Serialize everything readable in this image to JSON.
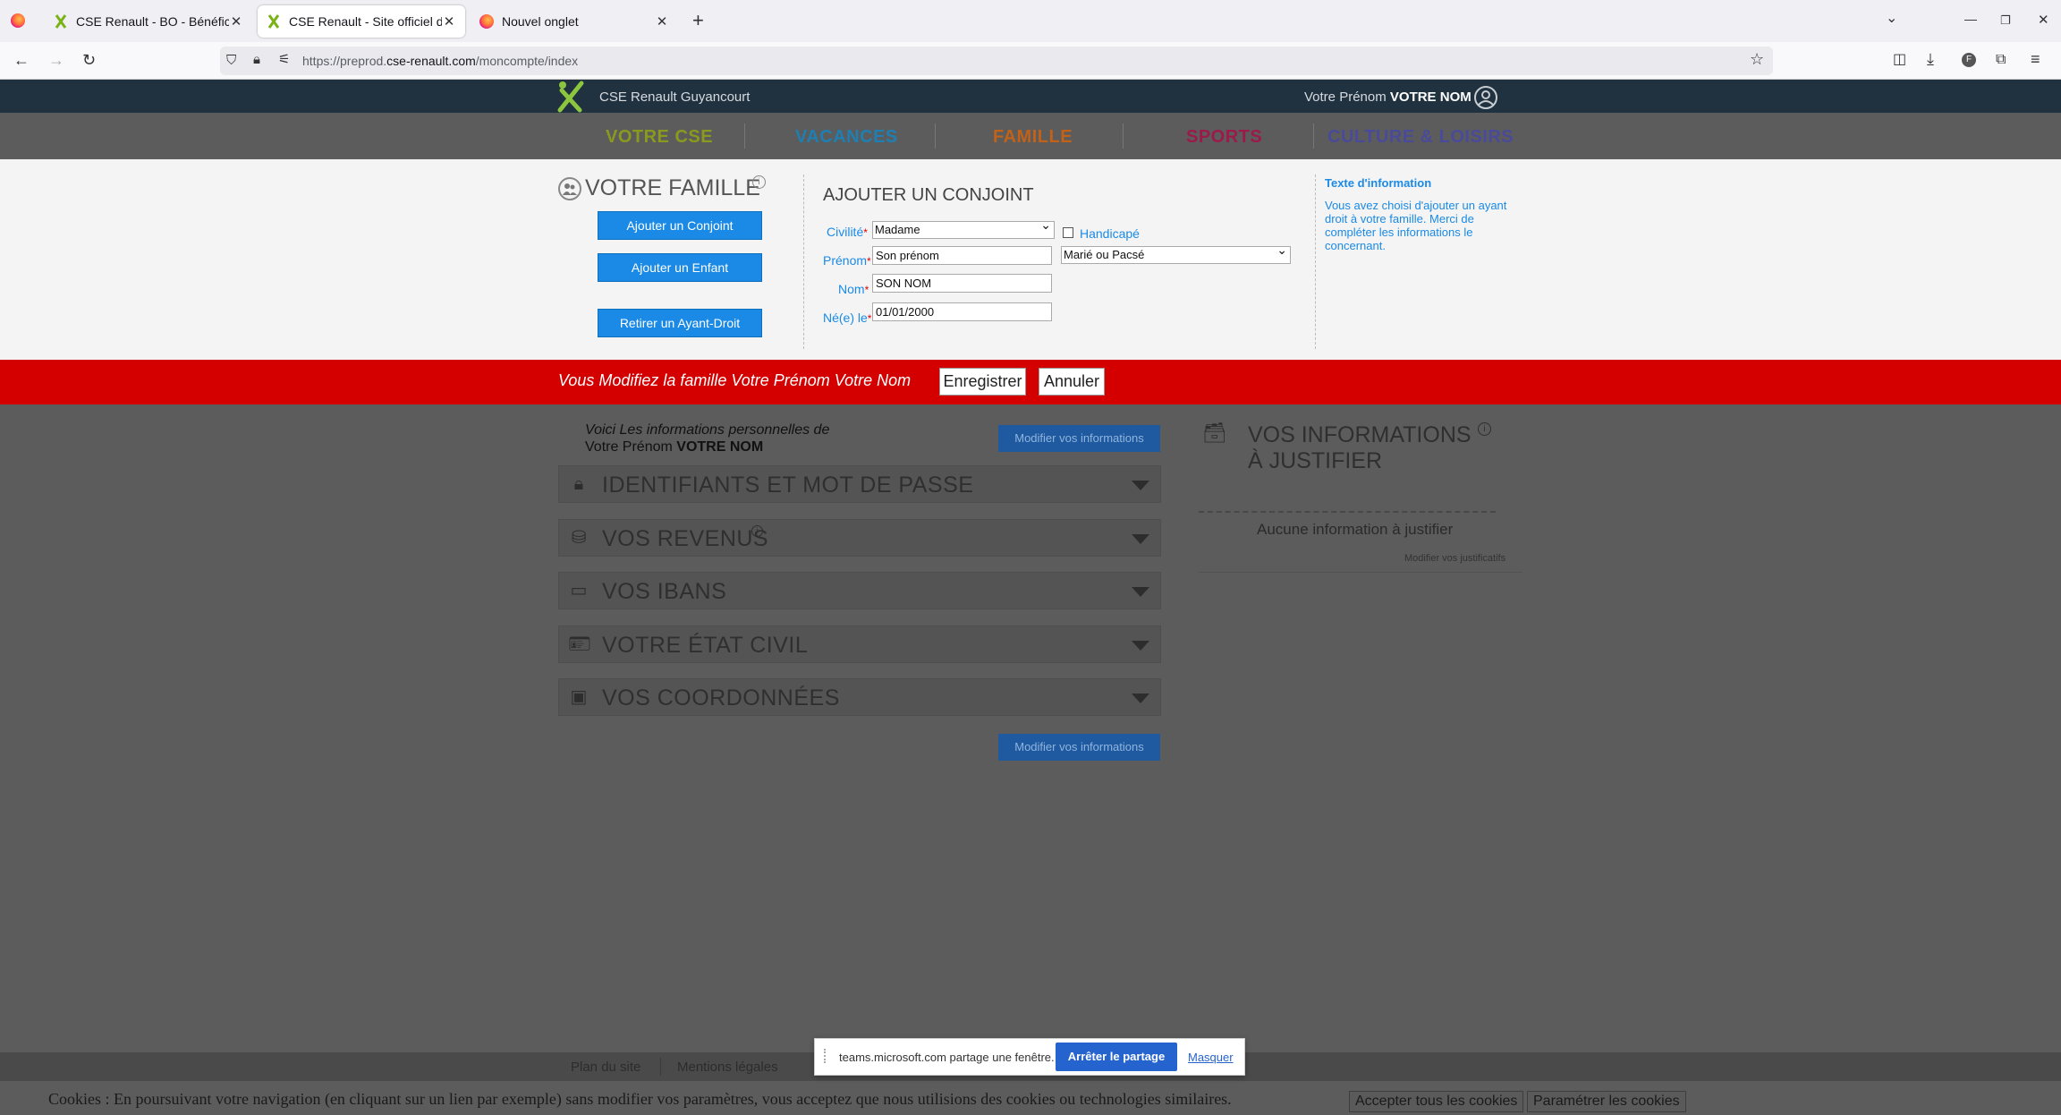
{
  "browser": {
    "tabs": [
      {
        "title": "CSE Renault - BO - Bénéficiaires"
      },
      {
        "title": "CSE Renault - Site officiel du Comité"
      },
      {
        "title": "Nouvel onglet"
      }
    ],
    "url_prefix": "https://preprod.",
    "url_domain": "cse-renault.com",
    "url_path": "/moncompte/index"
  },
  "header": {
    "site_name": "CSE Renault Guyancourt",
    "user_first": "Votre Prénom",
    "user_last": "VOTRE NOM"
  },
  "nav": [
    {
      "label": "VOTRE CSE",
      "color": "#8a9a1e"
    },
    {
      "label": "VACANCES",
      "color": "#1f7fb3"
    },
    {
      "label": "FAMILLE",
      "color": "#c0621a"
    },
    {
      "label": "SPORTS",
      "color": "#9c1a4a"
    },
    {
      "label": "CULTURE & LOISIRS",
      "color": "#4a4a9a"
    }
  ],
  "family": {
    "title": "VOTRE FAMILLE",
    "btn_conjoint": "Ajouter un Conjoint",
    "btn_enfant": "Ajouter un Enfant",
    "btn_retirer": "Retirer un Ayant-Droit"
  },
  "form": {
    "title": "AJOUTER UN CONJOINT",
    "civilite_label": "Civilité",
    "civilite_value": "Madame",
    "handicape_label": "Handicapé",
    "prenom_label": "Prénom",
    "prenom_value": "Son prénom",
    "statut_value": "Marié ou Pacsé",
    "nom_label": "Nom",
    "nom_value": "SON NOM",
    "naissance_label": "Né(e) le",
    "naissance_value": "01/01/2000",
    "required": "*"
  },
  "info": {
    "title": "Texte d'information",
    "text": "Vous avez choisi d'ajouter un ayant droit à votre famille. Merci de compléter les informations le concernant."
  },
  "editbar": {
    "text": "Vous Modifiez la famille Votre Prénom Votre Nom",
    "save": "Enregistrer",
    "cancel": "Annuler"
  },
  "account": {
    "greeting_line1": "Voici Les informations personnelles de",
    "greeting_first": "Votre Prénom",
    "greeting_last": "VOTRE NOM",
    "modify_btn": "Modifier vos informations",
    "sections": [
      {
        "label": "IDENTIFIANTS ET MOT DE PASSE",
        "icon": "lock-icon"
      },
      {
        "label": "VOS REVENUS",
        "icon": "coins-icon"
      },
      {
        "label": "VOS IBANS",
        "icon": "card-icon"
      },
      {
        "label": "VOTRE ÉTAT CIVIL",
        "icon": "id-card-icon"
      },
      {
        "label": "VOS COORDONNÉES",
        "icon": "wallet-icon"
      }
    ]
  },
  "justify": {
    "title_line1": "VOS INFORMATIONS",
    "title_line2": "À JUSTIFIER",
    "none": "Aucune information à justifier",
    "link": "Modifier vos justificatifs"
  },
  "footer": {
    "links": [
      "Plan du site",
      "Mentions légales"
    ]
  },
  "cookies": {
    "text": "Cookies : En poursuivant votre navigation (en cliquant sur un lien par exemple) sans modifier vos paramètres, vous acceptez que nous utilisions des cookies ou technologies similaires.",
    "accept": "Accepter tous les cookies",
    "settings": "Paramétrer les cookies"
  },
  "teams": {
    "text": "teams.microsoft.com partage une fenêtre.",
    "stop": "Arrêter le partage",
    "hide": "Masquer"
  }
}
